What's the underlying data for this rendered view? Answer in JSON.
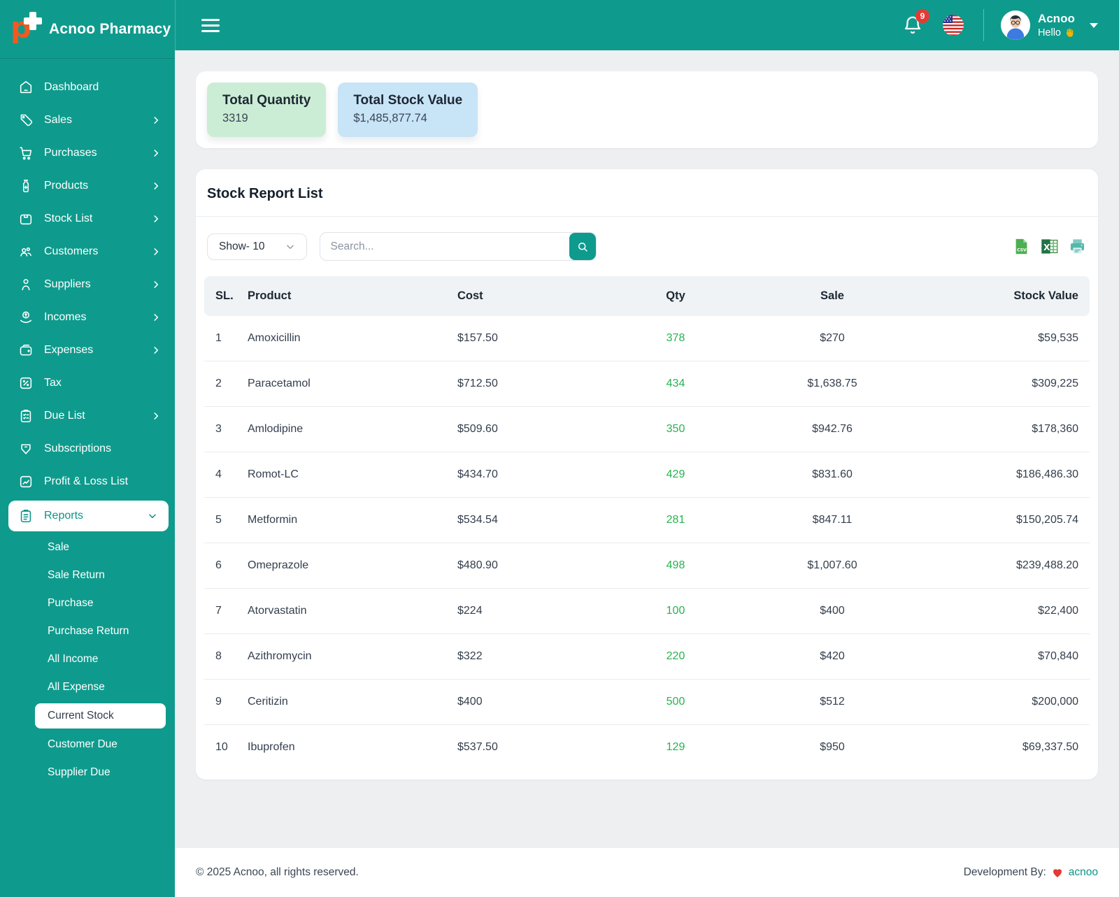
{
  "app": {
    "brand": "Acnoo Pharmacy"
  },
  "header": {
    "notification_count": "9",
    "user_name": "Acnoo",
    "greeting": "Hello",
    "icons": [
      "hamburger-icon",
      "bell-icon",
      "us-flag-icon",
      "avatar",
      "wave-icon",
      "chevron-down-icon"
    ]
  },
  "colors": {
    "accent_teal": "#0E9B8D",
    "active_text_teal": "#0D9488",
    "qty_green": "#27B350",
    "badge_red": "#E53935",
    "card_green_bg": "#CBEDD5",
    "card_blue_bg": "#C8E4F7",
    "page_bg": "#EDEFF1"
  },
  "sidebar": {
    "items": [
      {
        "label": "Dashboard",
        "icon": "home",
        "chevron": false
      },
      {
        "label": "Sales",
        "icon": "tag",
        "chevron": true
      },
      {
        "label": "Purchases",
        "icon": "cart",
        "chevron": true
      },
      {
        "label": "Products",
        "icon": "bottle",
        "chevron": true
      },
      {
        "label": "Stock List",
        "icon": "box",
        "chevron": true
      },
      {
        "label": "Customers",
        "icon": "users",
        "chevron": true
      },
      {
        "label": "Suppliers",
        "icon": "person",
        "chevron": true
      },
      {
        "label": "Incomes",
        "icon": "coin",
        "chevron": true
      },
      {
        "label": "Expenses",
        "icon": "wallet",
        "chevron": true
      },
      {
        "label": "Tax",
        "icon": "percent",
        "chevron": false
      },
      {
        "label": "Due List",
        "icon": "cliplist",
        "chevron": true
      },
      {
        "label": "Subscriptions",
        "icon": "shieldtag",
        "chevron": false
      },
      {
        "label": "Profit & Loss List",
        "icon": "chart",
        "chevron": false
      },
      {
        "label": "Reports",
        "icon": "clipboard",
        "chevron": true,
        "expanded": true,
        "active": true,
        "sub": [
          {
            "label": "Sale"
          },
          {
            "label": "Sale Return"
          },
          {
            "label": "Purchase"
          },
          {
            "label": "Purchase Return"
          },
          {
            "label": "All Income"
          },
          {
            "label": "All Expense"
          },
          {
            "label": "Current Stock",
            "active": true
          },
          {
            "label": "Customer Due"
          },
          {
            "label": "Supplier Due"
          }
        ]
      }
    ]
  },
  "summary": [
    {
      "title": "Total Quantity",
      "value": "3319"
    },
    {
      "title": "Total Stock Value",
      "value": "$1,485,877.74"
    }
  ],
  "report": {
    "title": "Stock Report List",
    "show_label": "Show- 10",
    "search_placeholder": "Search...",
    "export_icons": [
      "csv-export-icon",
      "excel-export-icon",
      "print-icon"
    ],
    "table": {
      "headers": [
        "SL.",
        "Product",
        "Cost",
        "Qty",
        "Sale",
        "Stock Value"
      ],
      "rows": [
        [
          "1",
          "Amoxicillin",
          "$157.50",
          "378",
          "$270",
          "$59,535"
        ],
        [
          "2",
          "Paracetamol",
          "$712.50",
          "434",
          "$1,638.75",
          "$309,225"
        ],
        [
          "3",
          "Amlodipine",
          "$509.60",
          "350",
          "$942.76",
          "$178,360"
        ],
        [
          "4",
          "Romot-LC",
          "$434.70",
          "429",
          "$831.60",
          "$186,486.30"
        ],
        [
          "5",
          "Metformin",
          "$534.54",
          "281",
          "$847.11",
          "$150,205.74"
        ],
        [
          "6",
          "Omeprazole",
          "$480.90",
          "498",
          "$1,007.60",
          "$239,488.20"
        ],
        [
          "7",
          "Atorvastatin",
          "$224",
          "100",
          "$400",
          "$22,400"
        ],
        [
          "8",
          "Azithromycin",
          "$322",
          "220",
          "$420",
          "$70,840"
        ],
        [
          "9",
          "Ceritizin",
          "$400",
          "500",
          "$512",
          "$200,000"
        ],
        [
          "10",
          "Ibuprofen",
          "$537.50",
          "129",
          "$950",
          "$69,337.50"
        ]
      ]
    }
  },
  "footer": {
    "copyright": "© 2025 Acnoo, all rights reserved.",
    "dev_prefix": "Development By:",
    "dev_link": "acnoo"
  }
}
